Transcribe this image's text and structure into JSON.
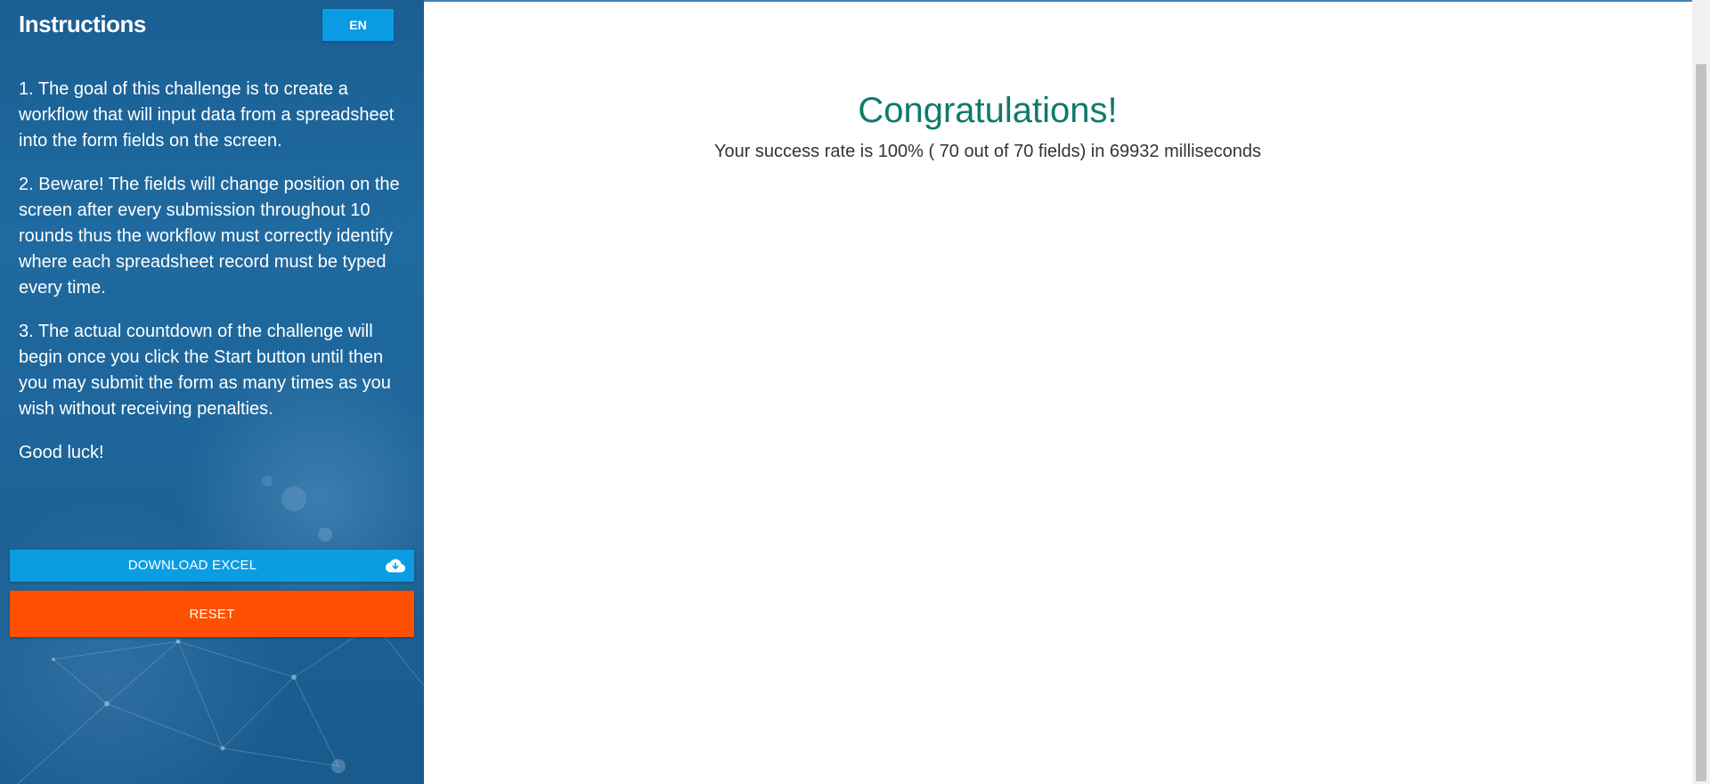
{
  "sidebar": {
    "title": "Instructions",
    "language_button": "EN",
    "instructions": [
      "1. The goal of this challenge is to create a workflow that will input data from a spreadsheet into the form fields on the screen.",
      "2. Beware! The fields will change position on the screen after every submission throughout 10 rounds thus the workflow must correctly identify where each spreadsheet record must be typed every time.",
      "3. The actual countdown of the challenge will begin once you click the Start button until then you may submit the form as many times as you wish without receiving penalties.",
      "Good luck!"
    ],
    "download_button": "DOWNLOAD EXCEL",
    "download_icon": "cloud-download-icon",
    "reset_button": "RESET"
  },
  "result": {
    "title": "Congratulations!",
    "message": "Your success rate is 100% ( 70 out of 70 fields) in 69932 milliseconds"
  },
  "colors": {
    "sidebar_blue": "#1d6499",
    "language_button": "#0b9be2",
    "download_button": "#0a9de2",
    "reset_button": "#fe5000",
    "title_green": "#0f7a6a"
  }
}
